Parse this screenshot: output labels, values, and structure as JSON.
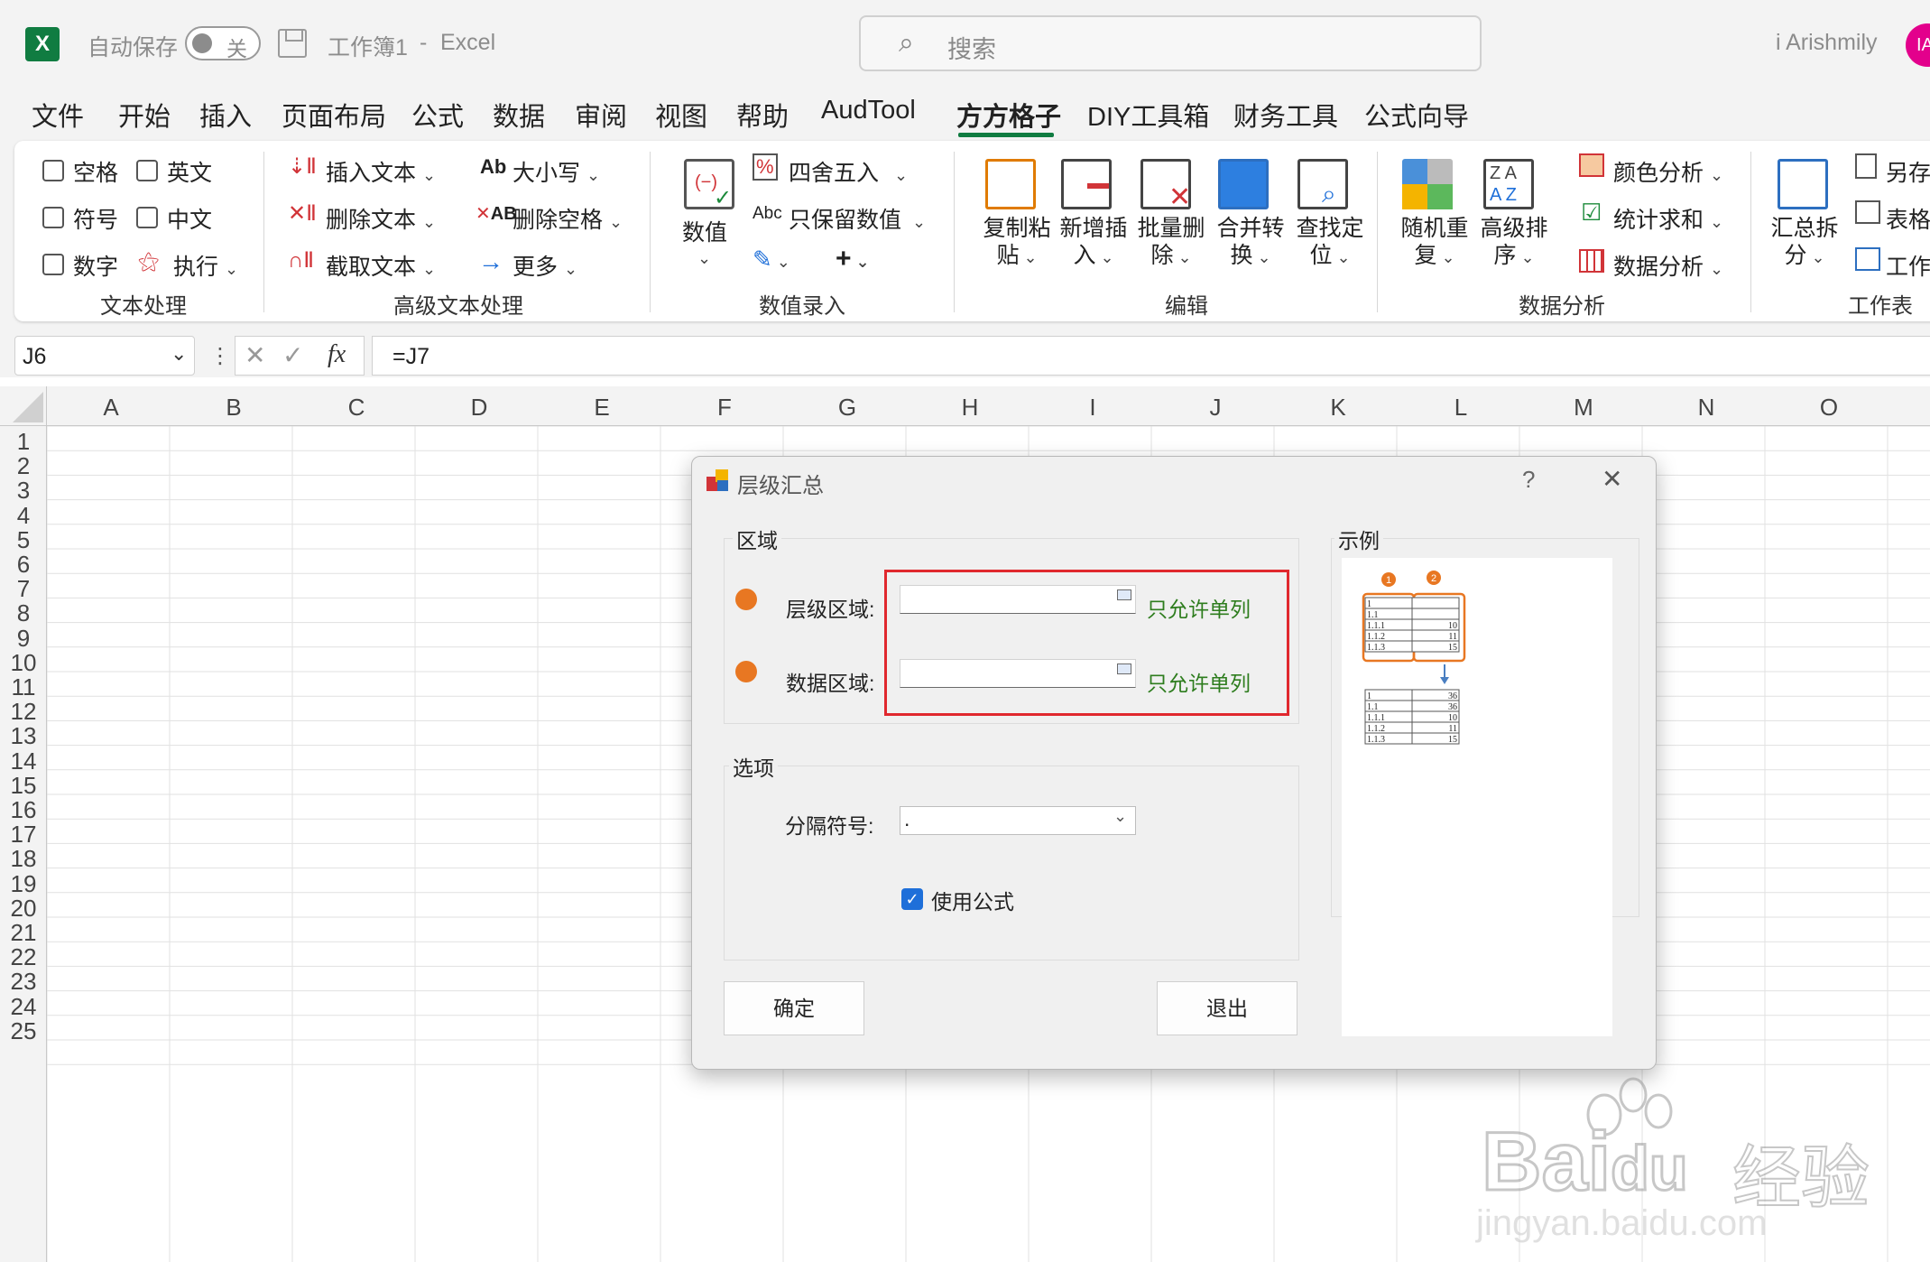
{
  "titlebar": {
    "app_badge": "X",
    "autosave_label": "自动保存",
    "autosave_state": "关",
    "document": "工作簿1",
    "dash": "-",
    "app": "Excel",
    "search_placeholder": "搜索",
    "user": "i Arishmily",
    "avatar": "IA"
  },
  "menu": {
    "items": [
      "文件",
      "开始",
      "插入",
      "页面布局",
      "公式",
      "数据",
      "审阅",
      "视图",
      "帮助",
      "AudTool",
      "方方格子",
      "DIY工具箱",
      "财务工具",
      "公式向导"
    ],
    "active": "方方格子"
  },
  "ribbon": {
    "text_group": {
      "label": "文本处理",
      "checkboxes": [
        "空格",
        "英文",
        "符号",
        "中文",
        "数字"
      ],
      "execute": "执行"
    },
    "advanced_text_group": {
      "label": "高级文本处理",
      "insert": "插入文本",
      "delete": "删除文本",
      "extract": "截取文本",
      "case": "大小写",
      "case_icon": "Ab",
      "trim": "删除空格",
      "more": "更多"
    },
    "entry_group": {
      "label": "数值录入",
      "number": "数值",
      "round": "四舍五入",
      "keep": "只保留数值",
      "keep_icon": "Abc",
      "plus": "+"
    },
    "edit_group": {
      "label": "编辑",
      "buttons": [
        {
          "l1": "复制粘",
          "l2": "贴"
        },
        {
          "l1": "新增插",
          "l2": "入"
        },
        {
          "l1": "批量删",
          "l2": "除"
        },
        {
          "l1": "合并转",
          "l2": "换"
        },
        {
          "l1": "查找定",
          "l2": "位"
        }
      ]
    },
    "analysis_group": {
      "label": "数据分析",
      "shuffle": {
        "l1": "随机重",
        "l2": "复"
      },
      "sort": {
        "l1": "高级排",
        "l2": "序"
      },
      "color": "颜色分析",
      "stats": "统计求和",
      "data": "数据分析"
    },
    "sheet_group": {
      "label": "工作表",
      "summary": {
        "l1": "汇总拆",
        "l2": "分"
      },
      "items": [
        "另存",
        "表格",
        "工作"
      ]
    }
  },
  "formula_bar": {
    "cell": "J6",
    "formula": "=J7",
    "fx": "fx"
  },
  "grid": {
    "columns": [
      "A",
      "B",
      "C",
      "D",
      "E",
      "F",
      "G",
      "H",
      "I",
      "J",
      "K",
      "L",
      "M",
      "N",
      "O"
    ],
    "rows": [
      "1",
      "2",
      "3",
      "4",
      "5",
      "6",
      "7",
      "8",
      "9",
      "10",
      "11",
      "12",
      "13",
      "14",
      "15",
      "16",
      "17",
      "18",
      "19",
      "20",
      "21",
      "22",
      "23",
      "24",
      "25"
    ]
  },
  "dialog": {
    "title": "层级汇总",
    "help": "?",
    "close": "✕",
    "region_group": "区域",
    "level_label": "层级区域:",
    "level_value": "",
    "data_label": "数据区域:",
    "data_value": "",
    "hint": "只允许单列",
    "options_group": "选项",
    "separator_label": "分隔符号:",
    "separator_value": ".",
    "use_formula_label": "使用公式",
    "use_formula_checked": true,
    "ok": "确定",
    "exit": "退出",
    "example_group": "示例",
    "example": {
      "badge1": "1",
      "badge2": "2",
      "top_rows": [
        [
          "1",
          ""
        ],
        [
          "1.1",
          ""
        ],
        [
          "1.1.1",
          "10"
        ],
        [
          "1.1.2",
          "11"
        ],
        [
          "1.1.3",
          "15"
        ]
      ],
      "bottom_rows": [
        [
          "1",
          "36"
        ],
        [
          "1.1",
          "36"
        ],
        [
          "1.1.1",
          "10"
        ],
        [
          "1.1.2",
          "11"
        ],
        [
          "1.1.3",
          "15"
        ]
      ]
    }
  },
  "watermark": {
    "brand": "Bai",
    "brand2": "du",
    "cn": "经验",
    "url": "jingyan.baidu.com"
  }
}
